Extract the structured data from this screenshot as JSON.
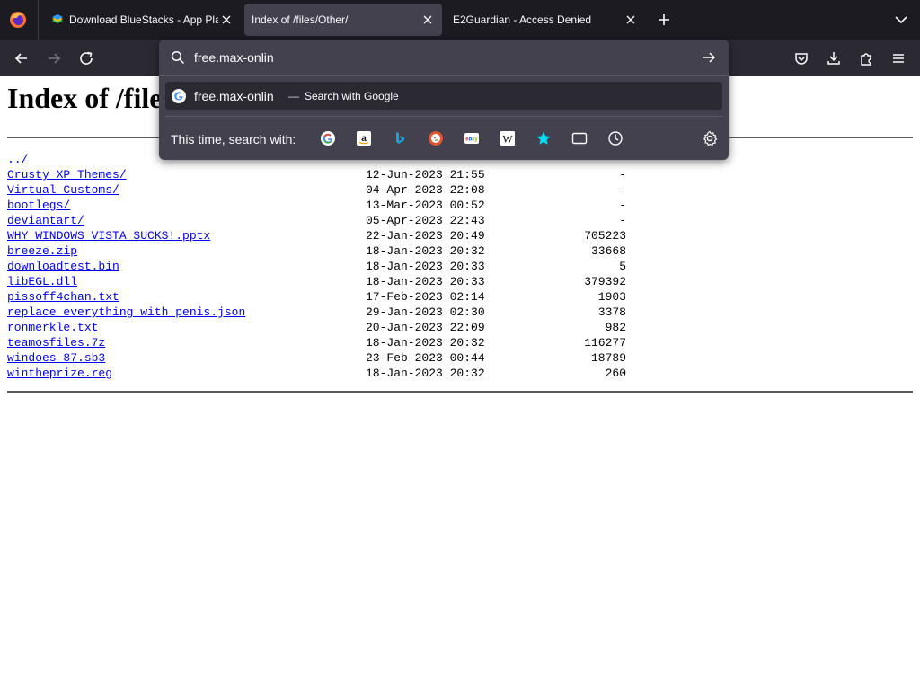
{
  "browser": {
    "tabs": [
      {
        "title": "Download BlueStacks - App Pla",
        "active": false,
        "favicon": "bluestacks-icon"
      },
      {
        "title": "Index of /files/Other/",
        "active": true,
        "favicon": ""
      },
      {
        "title": "E2Guardian - Access Denied",
        "active": false,
        "favicon": ""
      }
    ]
  },
  "urlbar": {
    "value": "free.max-onlin",
    "suggestion": {
      "query": "free.max-onlin",
      "separator": "—",
      "action": "Search with Google"
    },
    "search_with_label": "This time, search with:",
    "engines": [
      "google-icon",
      "amazon-icon",
      "bing-icon",
      "duckduckgo-icon",
      "ebay-icon",
      "wikipedia-icon",
      "bookmarks-icon",
      "tabs-icon",
      "history-icon"
    ]
  },
  "page": {
    "heading": "Index of /file",
    "entries": [
      {
        "name": "../",
        "date": "",
        "size": ""
      },
      {
        "name": "Crusty XP Themes/",
        "date": "12-Jun-2023 21:55",
        "size": "-"
      },
      {
        "name": "Virtual Customs/",
        "date": "04-Apr-2023 22:08",
        "size": "-"
      },
      {
        "name": "bootlegs/",
        "date": "13-Mar-2023 00:52",
        "size": "-"
      },
      {
        "name": "deviantart/",
        "date": "05-Apr-2023 22:43",
        "size": "-"
      },
      {
        "name": "WHY WINDOWS VISTA SUCKS!.pptx",
        "date": "22-Jan-2023 20:49",
        "size": "705223"
      },
      {
        "name": "breeze.zip",
        "date": "18-Jan-2023 20:32",
        "size": "33668"
      },
      {
        "name": "downloadtest.bin",
        "date": "18-Jan-2023 20:33",
        "size": "5"
      },
      {
        "name": "libEGL.dll",
        "date": "18-Jan-2023 20:33",
        "size": "379392"
      },
      {
        "name": "pissoff4chan.txt",
        "date": "17-Feb-2023 02:14",
        "size": "1903"
      },
      {
        "name": "replace everything with penis.json",
        "date": "29-Jan-2023 02:30",
        "size": "3378"
      },
      {
        "name": "ronmerkle.txt",
        "date": "20-Jan-2023 22:09",
        "size": "982"
      },
      {
        "name": "teamosfiles.7z",
        "date": "18-Jan-2023 20:32",
        "size": "116277"
      },
      {
        "name": "windoes 87.sb3",
        "date": "23-Feb-2023 00:44",
        "size": "18789"
      },
      {
        "name": "wintheprize.reg",
        "date": "18-Jan-2023 20:32",
        "size": "260"
      }
    ]
  },
  "colors": {
    "tabstrip_bg": "#1c1b22",
    "toolbar_bg": "#2b2a33",
    "active_tab_bg": "#42414d",
    "link": "#0000ee"
  }
}
